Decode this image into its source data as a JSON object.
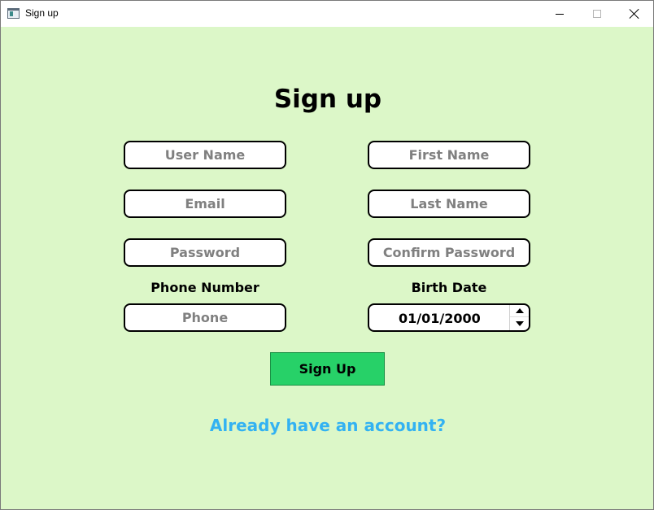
{
  "window": {
    "title": "Sign up",
    "icon": "app-window-icon"
  },
  "form": {
    "heading": "Sign up",
    "fields": {
      "username": {
        "placeholder": "User Name",
        "value": ""
      },
      "first_name": {
        "placeholder": "First Name",
        "value": ""
      },
      "email": {
        "placeholder": "Email",
        "value": ""
      },
      "last_name": {
        "placeholder": "Last Name",
        "value": ""
      },
      "password": {
        "placeholder": "Password",
        "value": ""
      },
      "confirm_password": {
        "placeholder": "Confirm Password",
        "value": ""
      },
      "phone": {
        "label": "Phone Number",
        "placeholder": "Phone",
        "value": ""
      },
      "birth_date": {
        "label": "Birth Date",
        "value": "01/01/2000"
      }
    },
    "submit_label": "Sign Up",
    "login_link": "Already have an account?"
  },
  "colors": {
    "background": "#dcf7c8",
    "button": "#27d168",
    "link": "#33b2f2",
    "placeholder": "#808080"
  }
}
